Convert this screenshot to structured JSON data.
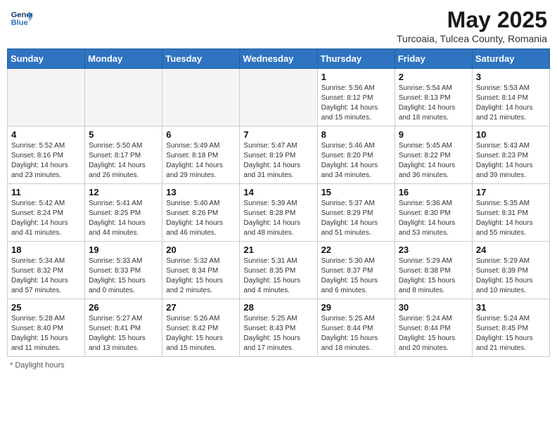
{
  "header": {
    "logo_line1": "General",
    "logo_line2": "Blue",
    "title": "May 2025",
    "subtitle": "Turcoaia, Tulcea County, Romania"
  },
  "days_of_week": [
    "Sunday",
    "Monday",
    "Tuesday",
    "Wednesday",
    "Thursday",
    "Friday",
    "Saturday"
  ],
  "weeks": [
    [
      {
        "day": "",
        "info": ""
      },
      {
        "day": "",
        "info": ""
      },
      {
        "day": "",
        "info": ""
      },
      {
        "day": "",
        "info": ""
      },
      {
        "day": "1",
        "info": "Sunrise: 5:56 AM\nSunset: 8:12 PM\nDaylight: 14 hours\nand 15 minutes."
      },
      {
        "day": "2",
        "info": "Sunrise: 5:54 AM\nSunset: 8:13 PM\nDaylight: 14 hours\nand 18 minutes."
      },
      {
        "day": "3",
        "info": "Sunrise: 5:53 AM\nSunset: 8:14 PM\nDaylight: 14 hours\nand 21 minutes."
      }
    ],
    [
      {
        "day": "4",
        "info": "Sunrise: 5:52 AM\nSunset: 8:16 PM\nDaylight: 14 hours\nand 23 minutes."
      },
      {
        "day": "5",
        "info": "Sunrise: 5:50 AM\nSunset: 8:17 PM\nDaylight: 14 hours\nand 26 minutes."
      },
      {
        "day": "6",
        "info": "Sunrise: 5:49 AM\nSunset: 8:18 PM\nDaylight: 14 hours\nand 29 minutes."
      },
      {
        "day": "7",
        "info": "Sunrise: 5:47 AM\nSunset: 8:19 PM\nDaylight: 14 hours\nand 31 minutes."
      },
      {
        "day": "8",
        "info": "Sunrise: 5:46 AM\nSunset: 8:20 PM\nDaylight: 14 hours\nand 34 minutes."
      },
      {
        "day": "9",
        "info": "Sunrise: 5:45 AM\nSunset: 8:22 PM\nDaylight: 14 hours\nand 36 minutes."
      },
      {
        "day": "10",
        "info": "Sunrise: 5:43 AM\nSunset: 8:23 PM\nDaylight: 14 hours\nand 39 minutes."
      }
    ],
    [
      {
        "day": "11",
        "info": "Sunrise: 5:42 AM\nSunset: 8:24 PM\nDaylight: 14 hours\nand 41 minutes."
      },
      {
        "day": "12",
        "info": "Sunrise: 5:41 AM\nSunset: 8:25 PM\nDaylight: 14 hours\nand 44 minutes."
      },
      {
        "day": "13",
        "info": "Sunrise: 5:40 AM\nSunset: 8:26 PM\nDaylight: 14 hours\nand 46 minutes."
      },
      {
        "day": "14",
        "info": "Sunrise: 5:39 AM\nSunset: 8:28 PM\nDaylight: 14 hours\nand 48 minutes."
      },
      {
        "day": "15",
        "info": "Sunrise: 5:37 AM\nSunset: 8:29 PM\nDaylight: 14 hours\nand 51 minutes."
      },
      {
        "day": "16",
        "info": "Sunrise: 5:36 AM\nSunset: 8:30 PM\nDaylight: 14 hours\nand 53 minutes."
      },
      {
        "day": "17",
        "info": "Sunrise: 5:35 AM\nSunset: 8:31 PM\nDaylight: 14 hours\nand 55 minutes."
      }
    ],
    [
      {
        "day": "18",
        "info": "Sunrise: 5:34 AM\nSunset: 8:32 PM\nDaylight: 14 hours\nand 57 minutes."
      },
      {
        "day": "19",
        "info": "Sunrise: 5:33 AM\nSunset: 8:33 PM\nDaylight: 15 hours\nand 0 minutes."
      },
      {
        "day": "20",
        "info": "Sunrise: 5:32 AM\nSunset: 8:34 PM\nDaylight: 15 hours\nand 2 minutes."
      },
      {
        "day": "21",
        "info": "Sunrise: 5:31 AM\nSunset: 8:35 PM\nDaylight: 15 hours\nand 4 minutes."
      },
      {
        "day": "22",
        "info": "Sunrise: 5:30 AM\nSunset: 8:37 PM\nDaylight: 15 hours\nand 6 minutes."
      },
      {
        "day": "23",
        "info": "Sunrise: 5:29 AM\nSunset: 8:38 PM\nDaylight: 15 hours\nand 8 minutes."
      },
      {
        "day": "24",
        "info": "Sunrise: 5:29 AM\nSunset: 8:39 PM\nDaylight: 15 hours\nand 10 minutes."
      }
    ],
    [
      {
        "day": "25",
        "info": "Sunrise: 5:28 AM\nSunset: 8:40 PM\nDaylight: 15 hours\nand 11 minutes."
      },
      {
        "day": "26",
        "info": "Sunrise: 5:27 AM\nSunset: 8:41 PM\nDaylight: 15 hours\nand 13 minutes."
      },
      {
        "day": "27",
        "info": "Sunrise: 5:26 AM\nSunset: 8:42 PM\nDaylight: 15 hours\nand 15 minutes."
      },
      {
        "day": "28",
        "info": "Sunrise: 5:25 AM\nSunset: 8:43 PM\nDaylight: 15 hours\nand 17 minutes."
      },
      {
        "day": "29",
        "info": "Sunrise: 5:25 AM\nSunset: 8:44 PM\nDaylight: 15 hours\nand 18 minutes."
      },
      {
        "day": "30",
        "info": "Sunrise: 5:24 AM\nSunset: 8:44 PM\nDaylight: 15 hours\nand 20 minutes."
      },
      {
        "day": "31",
        "info": "Sunrise: 5:24 AM\nSunset: 8:45 PM\nDaylight: 15 hours\nand 21 minutes."
      }
    ]
  ],
  "footer": {
    "note": "Daylight hours"
  }
}
